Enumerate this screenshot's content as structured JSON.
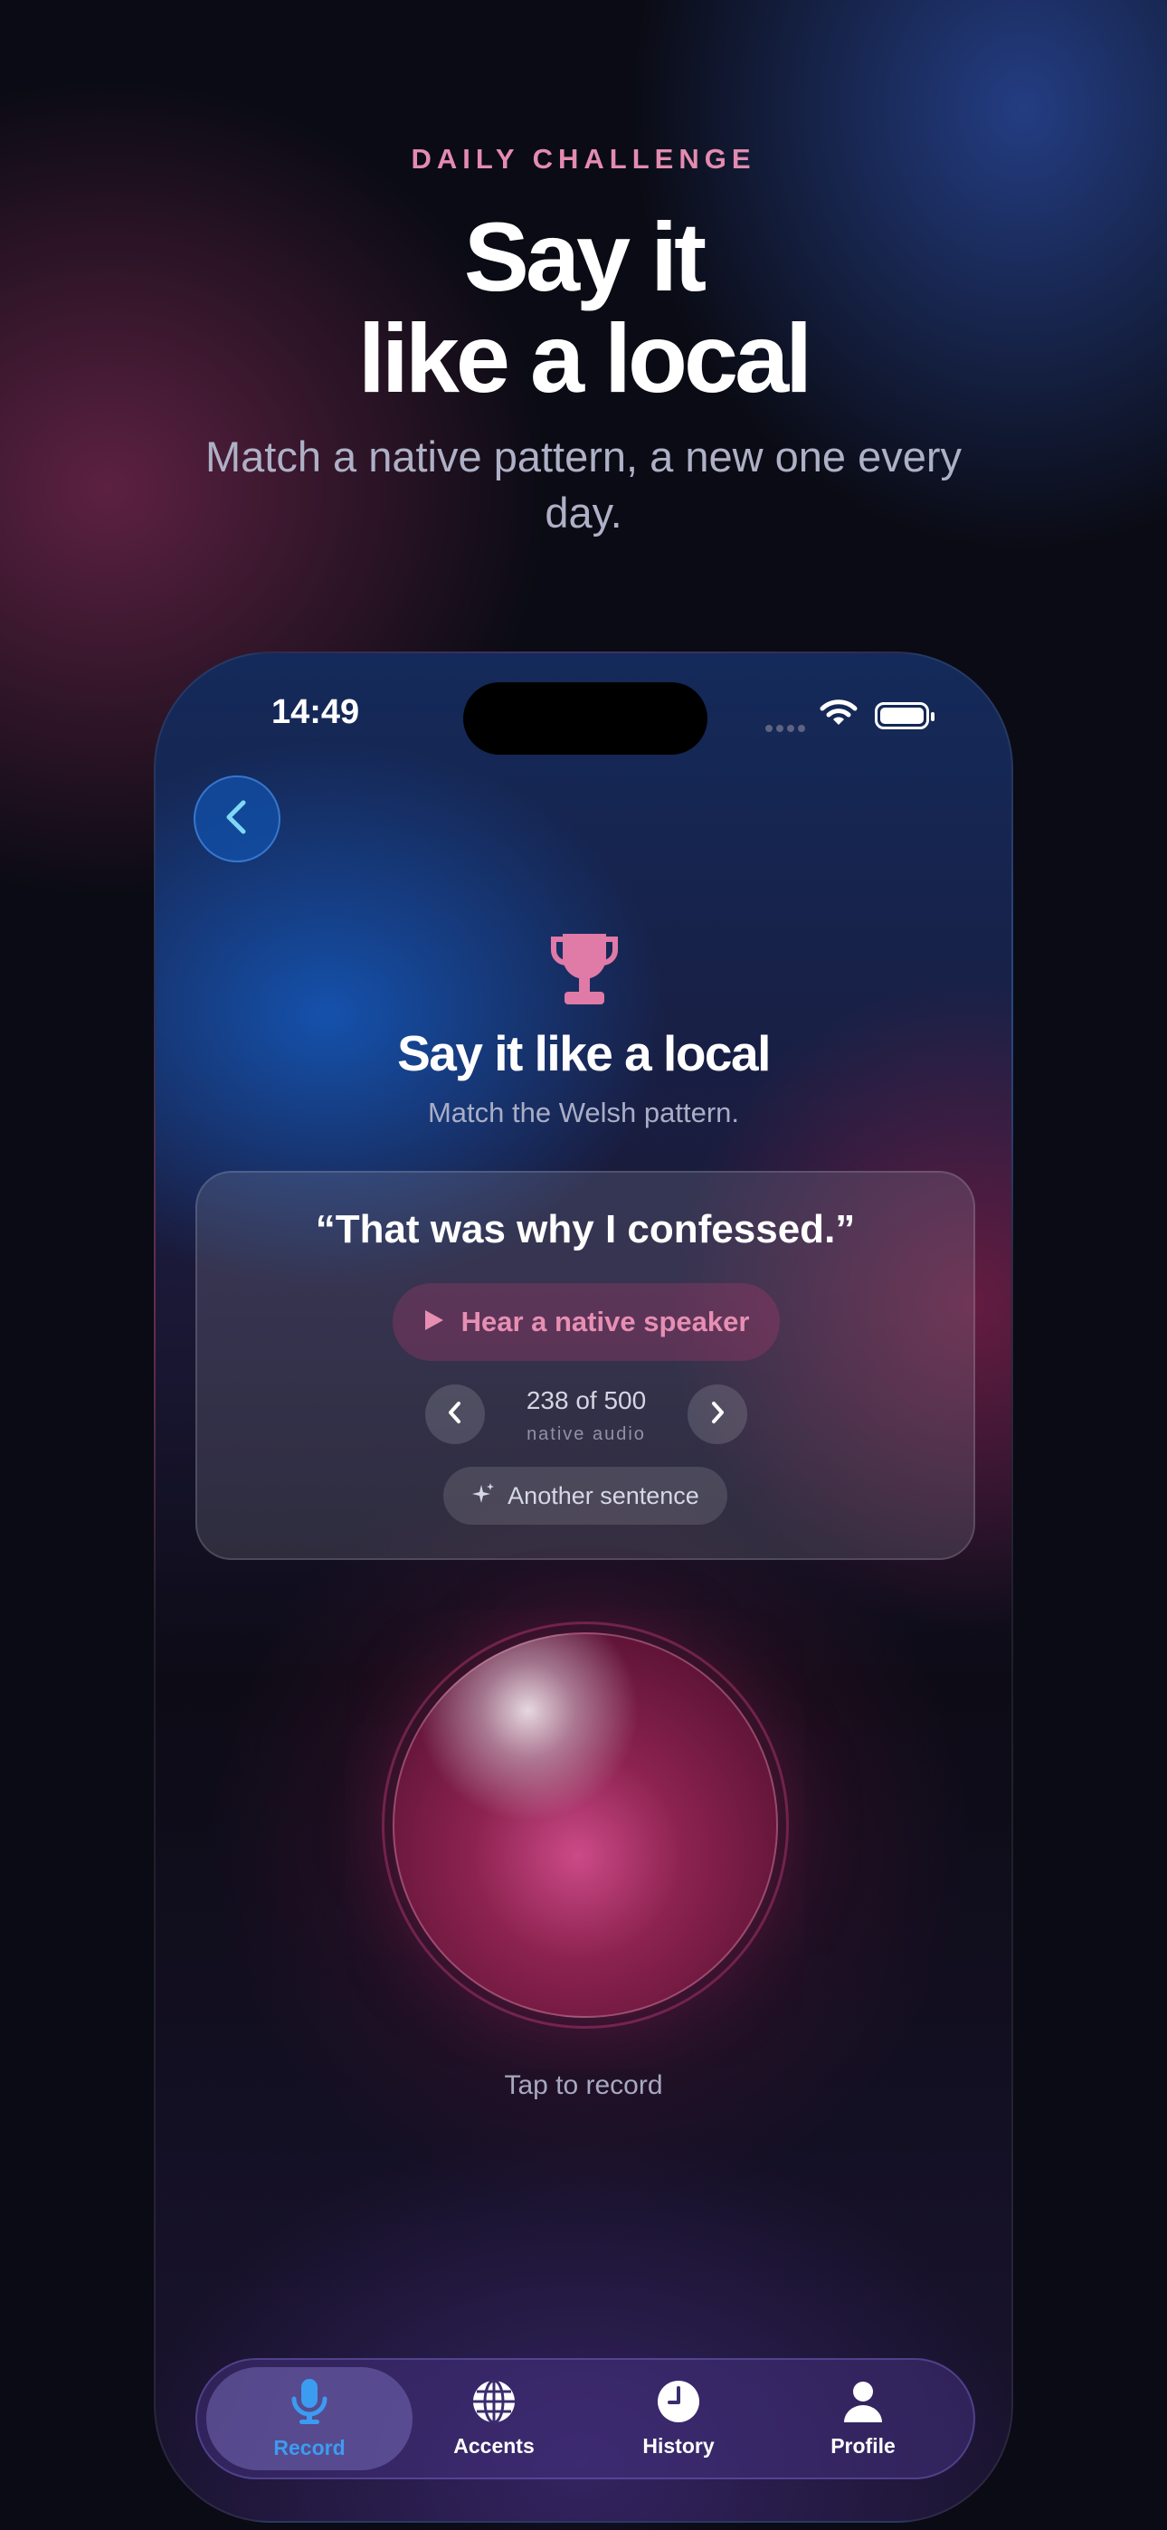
{
  "promo": {
    "eyebrow": "DAILY CHALLENGE",
    "headline_line1": "Say it",
    "headline_line2": "like a local",
    "subhead": "Match a native pattern, a new one every day."
  },
  "status_bar": {
    "time": "14:49"
  },
  "challenge": {
    "title": "Say it like a local",
    "subtitle": "Match the Welsh pattern.",
    "icon": "trophy-icon"
  },
  "card": {
    "sentence": "“That was why I confessed.”",
    "hear_button": "Hear a native speaker",
    "counter": "238 of 500",
    "counter_sub": "native audio",
    "another_button": "Another sentence"
  },
  "record": {
    "label": "Tap to record"
  },
  "tabbar": {
    "tabs": [
      {
        "label": "Record",
        "icon": "microphone-icon",
        "active": true
      },
      {
        "label": "Accents",
        "icon": "globe-icon",
        "active": false
      },
      {
        "label": "History",
        "icon": "clock-icon",
        "active": false
      },
      {
        "label": "Profile",
        "icon": "person-icon",
        "active": false
      }
    ]
  },
  "colors": {
    "accent_pink": "#e78fb3",
    "accent_blue": "#3b9cf0",
    "background": "#0a0b14"
  }
}
